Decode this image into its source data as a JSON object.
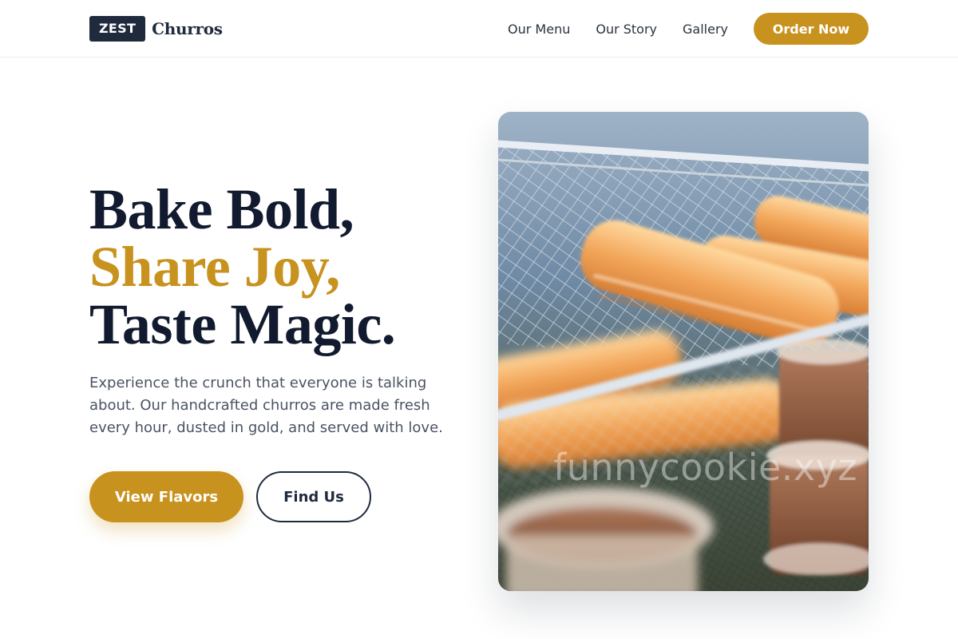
{
  "header": {
    "logo_badge": "ZEST",
    "logo_name": "Churros",
    "nav": [
      {
        "label": "Our Menu"
      },
      {
        "label": "Our Story"
      },
      {
        "label": "Gallery"
      }
    ],
    "cta_label": "Order Now"
  },
  "hero": {
    "title_lines": [
      "Bake Bold,",
      "Share Joy,",
      "Taste Magic."
    ],
    "description": "Experience the crunch that everyone is talking about. Our handcrafted churros are made fresh every hour, dusted in gold, and served with love.",
    "primary_button": "View Flavors",
    "secondary_button": "Find Us",
    "image_watermark": "funnycookie.xyz"
  },
  "colors": {
    "accent": "#c8921e",
    "dark": "#1f2a3d",
    "headline": "#111a2e",
    "body_text": "#4a5363"
  }
}
